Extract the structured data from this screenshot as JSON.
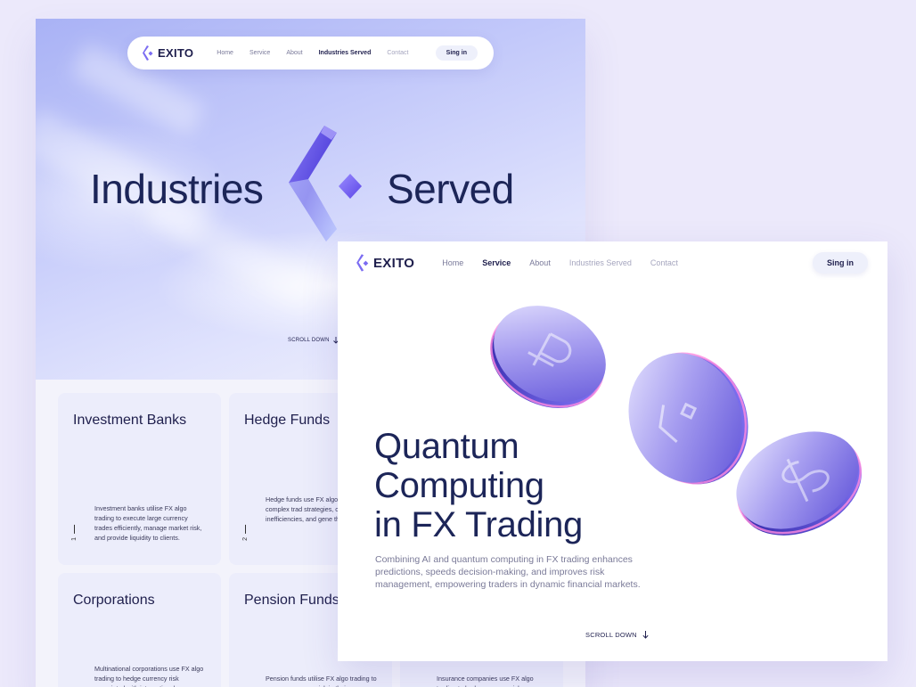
{
  "back": {
    "nav": {
      "logo": "EXITO",
      "links": [
        "Home",
        "Service",
        "About",
        "Industries Served",
        "Contact"
      ],
      "signin": "Sing in"
    },
    "hero": {
      "word_left": "Industries",
      "word_right": "Served",
      "scroll": "SCROLL DOWN"
    },
    "cards": [
      {
        "title": "Investment Banks",
        "num": "1",
        "desc": "Investment banks utilise FX algo trading to execute large currency trades efficiently, manage market risk, and provide liquidity to clients."
      },
      {
        "title": "Hedge Funds",
        "num": "2",
        "desc": "Hedge funds use FX algo implement complex trad strategies, capitalise on inefficiencies, and gene their portfolios."
      },
      {
        "title": "Corporations",
        "num": "",
        "desc": "Multinational corporations use FX algo trading to hedge currency risk associated with international"
      },
      {
        "title": "Pension Funds",
        "num": "",
        "desc": "Pension funds utilise FX algo trading to manage currency risk in their"
      },
      {
        "title": "",
        "num": "",
        "desc": "Insurance companies use FX algo trading to hedge currency risk"
      }
    ]
  },
  "front": {
    "nav": {
      "logo": "EXITO",
      "links": [
        "Home",
        "Service",
        "About",
        "Industries Served",
        "Contact"
      ],
      "signin": "Sing in"
    },
    "title_lines": [
      "Quantum",
      "Computing",
      "in FX Trading"
    ],
    "description": "Combining AI and quantum computing in FX trading enhances predictions, speeds decision-making, and improves risk management, empowering traders in dynamic financial markets.",
    "scroll": "SCROLL DOWN"
  },
  "colors": {
    "background": "#ece9fb",
    "accent": "#6b5cf0",
    "text_dark": "#1c2558"
  }
}
